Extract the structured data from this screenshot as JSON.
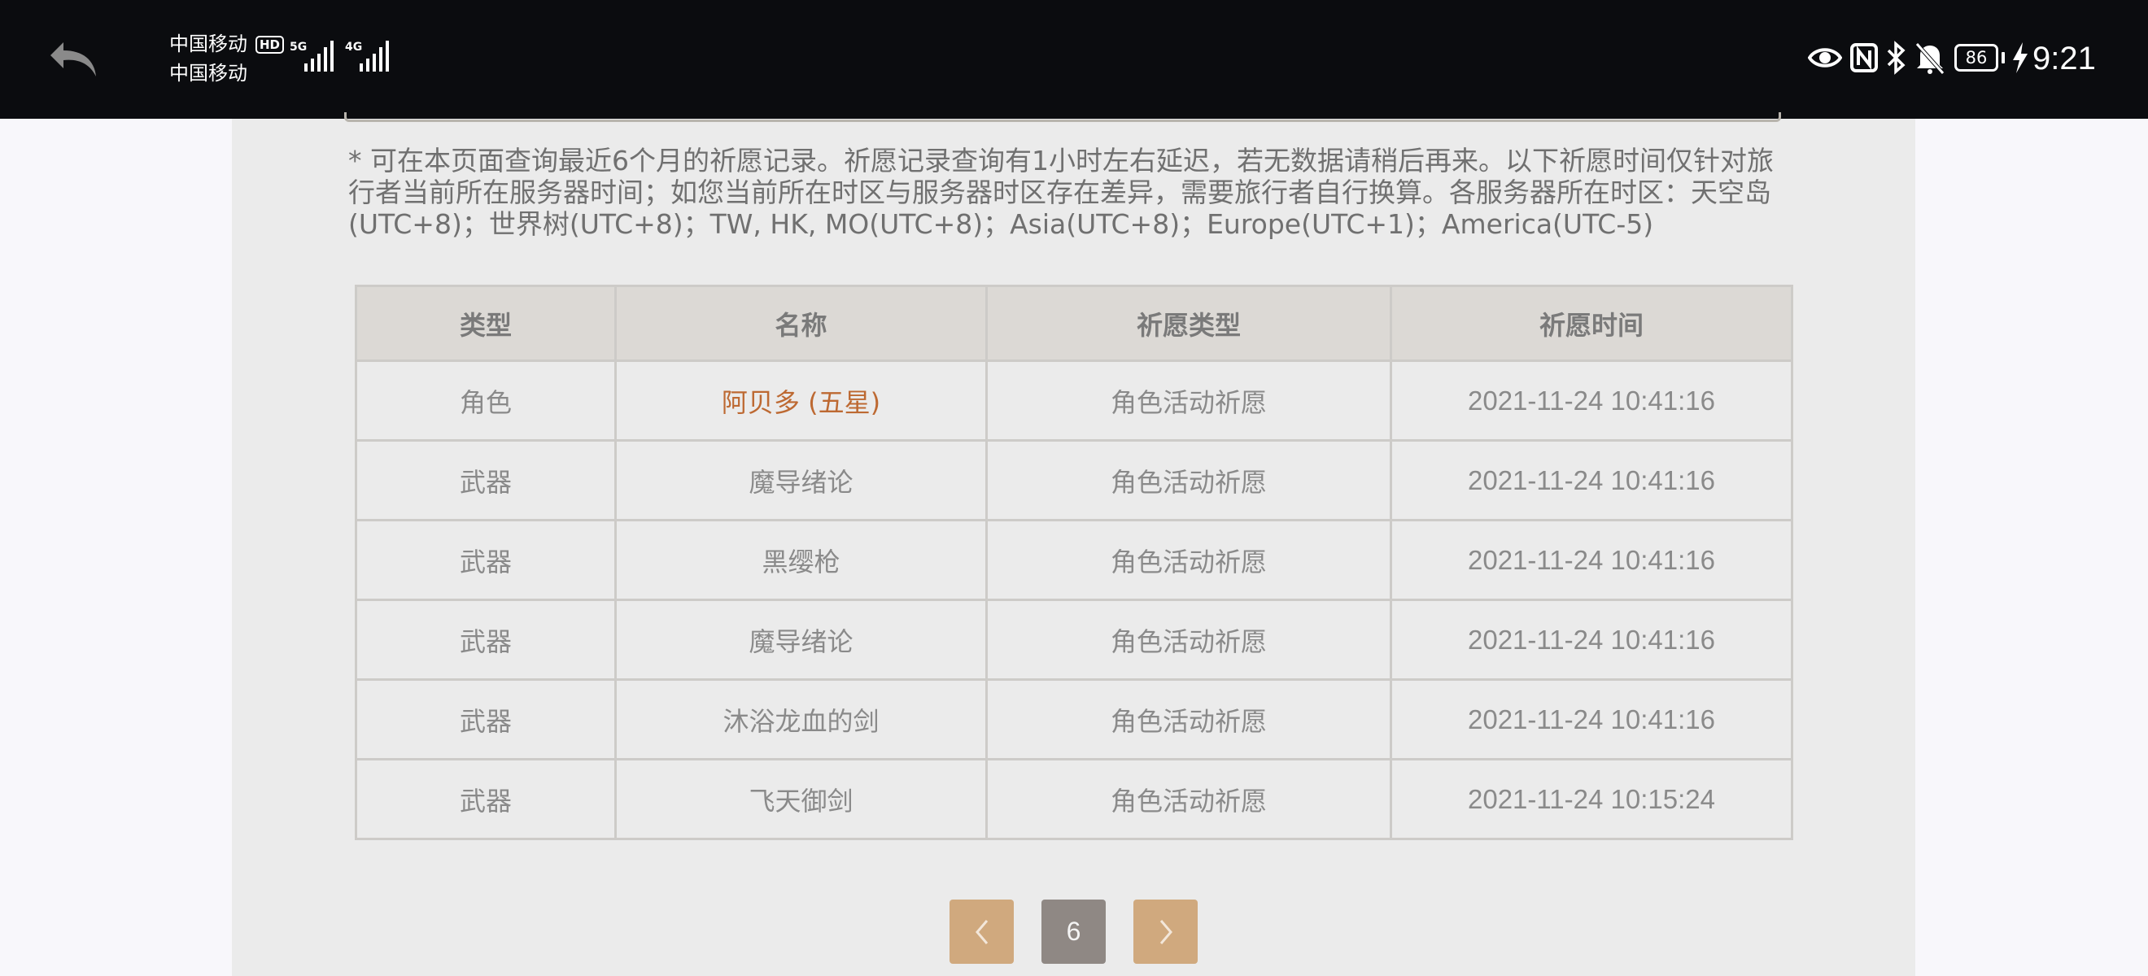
{
  "status_bar": {
    "carrier_1": "中国移动",
    "carrier_2": "中国移动",
    "hd_badge": "HD",
    "network_1": "5G",
    "network_2": "4G",
    "battery_level": "86",
    "time": "9:21",
    "icons": [
      "back-arrow-icon",
      "signal-icon",
      "eye-comfort-icon",
      "nfc-icon",
      "bluetooth-icon",
      "mute-icon",
      "charging-icon"
    ]
  },
  "notice": "* 可在本页面查询最近6个月的祈愿记录。祈愿记录查询有1小时左右延迟，若无数据请稍后再来。以下祈愿时间仅针对旅行者当前所在服务器时间；如您当前所在时区与服务器时区存在差异，需要旅行者自行换算。各服务器所在时区：天空岛(UTC+8)；世界树(UTC+8)；TW, HK, MO(UTC+8)；Asia(UTC+8)；Europe(UTC+1)；America(UTC-5)",
  "table": {
    "headers": [
      "类型",
      "名称",
      "祈愿类型",
      "祈愿时间"
    ],
    "rows": [
      {
        "type": "角色",
        "name": "阿贝多 (五星)",
        "wish_type": "角色活动祈愿",
        "time": "2021-11-24 10:41:16"
      },
      {
        "type": "武器",
        "name": "魔导绪论",
        "wish_type": "角色活动祈愿",
        "time": "2021-11-24 10:41:16"
      },
      {
        "type": "武器",
        "name": "黑缨枪",
        "wish_type": "角色活动祈愿",
        "time": "2021-11-24 10:41:16"
      },
      {
        "type": "武器",
        "name": "魔导绪论",
        "wish_type": "角色活动祈愿",
        "time": "2021-11-24 10:41:16"
      },
      {
        "type": "武器",
        "name": "沐浴龙血的剑",
        "wish_type": "角色活动祈愿",
        "time": "2021-11-24 10:41:16"
      },
      {
        "type": "武器",
        "name": "飞天御剑",
        "wish_type": "角色活动祈愿",
        "time": "2021-11-24 10:15:24"
      }
    ]
  },
  "pagination": {
    "current_page": "6"
  },
  "colors": {
    "five_star": "#bd6932",
    "pager_button": "#d0a97e",
    "pager_current": "#8f8884"
  }
}
